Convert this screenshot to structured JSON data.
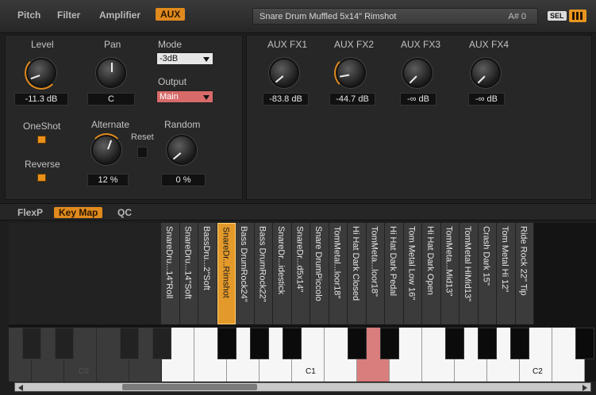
{
  "tabs": [
    {
      "label": "Pitch"
    },
    {
      "label": "Filter"
    },
    {
      "label": "Amplifier"
    },
    {
      "label": "AUX"
    }
  ],
  "preset": {
    "name": "Snare Drum Muffled 5x14\" Rimshot",
    "note": "A# 0"
  },
  "sel_label": "SEL",
  "left": {
    "level": {
      "label": "Level",
      "value": "-11.3 dB"
    },
    "pan": {
      "label": "Pan",
      "value": "C"
    },
    "mode": {
      "label": "Mode",
      "value": "-3dB"
    },
    "output": {
      "label": "Output",
      "value": "Main"
    },
    "oneshot": {
      "label": "OneShot"
    },
    "reverse": {
      "label": "Reverse"
    },
    "alternate": {
      "label": "Alternate",
      "value": "12 %"
    },
    "reset": {
      "label": "Reset"
    },
    "random": {
      "label": "Random",
      "value": "0 %"
    }
  },
  "aux": [
    {
      "label": "AUX FX1",
      "value": "-83.8 dB"
    },
    {
      "label": "AUX FX2",
      "value": "-44.7 dB"
    },
    {
      "label": "AUX FX3",
      "value": "-∞ dB"
    },
    {
      "label": "AUX FX4",
      "value": "-∞ dB"
    }
  ],
  "midtabs": [
    {
      "label": "FlexP"
    },
    {
      "label": "Key Map"
    },
    {
      "label": "QC"
    }
  ],
  "keymap": {
    "slots": [
      "SnareDru...14\"Roll",
      "SnareDru...14\"Soft",
      "BassDru...2\"Soft",
      "SnareDr...Rimshot",
      "Bass DrumRock24\"",
      "Bass DrumRock22\"",
      "SnareDr...idestick",
      "SnareDr...d5x14\"",
      "Snare DrumPiccolo",
      "TomMetal...loor18\"",
      "Hi Hat Dark Closed",
      "TomMeta...loor18\"",
      "Hi Hat Dark Pedal",
      "Tom Metal Low 16\"",
      "Hi Hat Dark Open",
      "TomMeta...Mid13\"",
      "TomMetal HiMid13\"",
      "Crash Dark 15\"",
      "Tom Metal Hi 12\"",
      "Ride Rock 22\" Tip"
    ],
    "c_labels": {
      "c0": "C0",
      "c1": "C1",
      "c2": "C2"
    }
  }
}
